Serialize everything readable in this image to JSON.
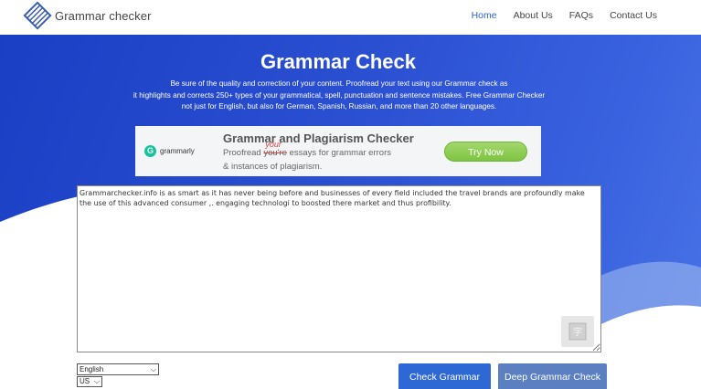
{
  "header": {
    "logo_text": "Grammar checker",
    "nav": [
      {
        "label": "Home",
        "active": true
      },
      {
        "label": "About Us",
        "active": false
      },
      {
        "label": "FAQs",
        "active": false
      },
      {
        "label": "Contact Us",
        "active": false
      }
    ]
  },
  "hero": {
    "title": "Grammar Check",
    "desc_line1": "Be sure of the quality and correction of your content. Proofread your text using our Grammar check as",
    "desc_line2": "it highlights and corrects 250+ types of your grammatical, spell, punctuation and sentence mistakes. Free Grammar Checker",
    "desc_line3": "not just for English, but also for German, Spanish, Russian, and more than 20 other languages."
  },
  "ad": {
    "brand": "grammarly",
    "title": "Grammar and Plagiarism Checker",
    "line1_prefix": "Proofread ",
    "line1_struck": "you're",
    "line1_correction": "your",
    "line1_suffix": " essays for grammar errors",
    "line2": "& instances of plagiarism.",
    "cta": "Try Now"
  },
  "editor": {
    "text": "Grammarchecker.info is as smart as it has never being before and businesses of every field included the travel brands are profoundly make the use of this advanced consumer ,. engaging technologi to boosted there market and thus profibility."
  },
  "controls": {
    "language": "English",
    "region": "US",
    "check_label": "Check Grammar",
    "deep_label": "Deep Grammar Check"
  },
  "colors": {
    "hero_bg": "#2a4fd1",
    "check_button": "#2e68d4",
    "deep_button": "#5b7fc0",
    "cta_green": "#7dc443"
  }
}
